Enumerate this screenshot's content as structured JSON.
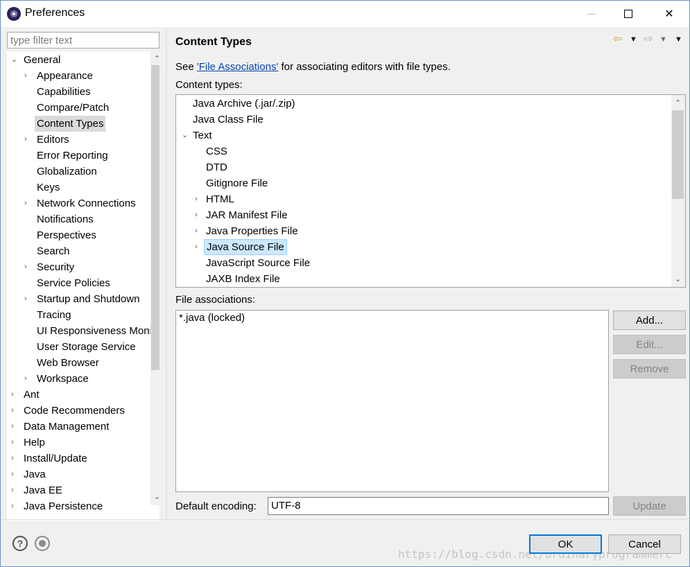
{
  "window": {
    "title": "Preferences",
    "minimize_glyph": "—",
    "close_glyph": "✕"
  },
  "left": {
    "filter_placeholder": "type filter text",
    "tree": [
      {
        "label": "General",
        "level": 0,
        "chevron": "⌄"
      },
      {
        "label": "Appearance",
        "level": 1,
        "chevron": "›"
      },
      {
        "label": "Capabilities",
        "level": 1,
        "chevron": ""
      },
      {
        "label": "Compare/Patch",
        "level": 1,
        "chevron": ""
      },
      {
        "label": "Content Types",
        "level": 1,
        "chevron": "",
        "selected": true
      },
      {
        "label": "Editors",
        "level": 1,
        "chevron": "›"
      },
      {
        "label": "Error Reporting",
        "level": 1,
        "chevron": ""
      },
      {
        "label": "Globalization",
        "level": 1,
        "chevron": ""
      },
      {
        "label": "Keys",
        "level": 1,
        "chevron": ""
      },
      {
        "label": "Network Connections",
        "level": 1,
        "chevron": "›"
      },
      {
        "label": "Notifications",
        "level": 1,
        "chevron": ""
      },
      {
        "label": "Perspectives",
        "level": 1,
        "chevron": ""
      },
      {
        "label": "Search",
        "level": 1,
        "chevron": ""
      },
      {
        "label": "Security",
        "level": 1,
        "chevron": "›"
      },
      {
        "label": "Service Policies",
        "level": 1,
        "chevron": ""
      },
      {
        "label": "Startup and Shutdown",
        "level": 1,
        "chevron": "›"
      },
      {
        "label": "Tracing",
        "level": 1,
        "chevron": ""
      },
      {
        "label": "UI Responsiveness Monitoring",
        "level": 1,
        "chevron": ""
      },
      {
        "label": "User Storage Service",
        "level": 1,
        "chevron": ""
      },
      {
        "label": "Web Browser",
        "level": 1,
        "chevron": ""
      },
      {
        "label": "Workspace",
        "level": 1,
        "chevron": "›"
      },
      {
        "label": "Ant",
        "level": 0,
        "chevron": "›"
      },
      {
        "label": "Code Recommenders",
        "level": 0,
        "chevron": "›"
      },
      {
        "label": "Data Management",
        "level": 0,
        "chevron": "›"
      },
      {
        "label": "Help",
        "level": 0,
        "chevron": "›"
      },
      {
        "label": "Install/Update",
        "level": 0,
        "chevron": "›"
      },
      {
        "label": "Java",
        "level": 0,
        "chevron": "›"
      },
      {
        "label": "Java EE",
        "level": 0,
        "chevron": "›"
      },
      {
        "label": "Java Persistence",
        "level": 0,
        "chevron": "›"
      }
    ]
  },
  "right": {
    "title": "Content Types",
    "description_prefix": "See ",
    "description_link": "'File Associations'",
    "description_suffix": " for associating editors with file types.",
    "content_types_label": "Content types:",
    "content_types": [
      {
        "label": "Java Archive (.jar/.zip)",
        "level": 0,
        "chevron": ""
      },
      {
        "label": "Java Class File",
        "level": 0,
        "chevron": ""
      },
      {
        "label": "Text",
        "level": 0,
        "chevron": "⌄"
      },
      {
        "label": "CSS",
        "level": 1,
        "chevron": ""
      },
      {
        "label": "DTD",
        "level": 1,
        "chevron": ""
      },
      {
        "label": "Gitignore File",
        "level": 1,
        "chevron": ""
      },
      {
        "label": "HTML",
        "level": 1,
        "chevron": "›"
      },
      {
        "label": "JAR Manifest File",
        "level": 1,
        "chevron": "›"
      },
      {
        "label": "Java Properties File",
        "level": 1,
        "chevron": "›"
      },
      {
        "label": "Java Source File",
        "level": 1,
        "chevron": "›",
        "selected": true
      },
      {
        "label": "JavaScript Source File",
        "level": 1,
        "chevron": ""
      },
      {
        "label": "JAXB Index File",
        "level": 1,
        "chevron": ""
      }
    ],
    "file_associations_label": "File associations:",
    "file_associations": [
      "*.java (locked)"
    ],
    "buttons": {
      "add": "Add...",
      "edit": "Edit...",
      "remove": "Remove",
      "update": "Update"
    },
    "default_encoding_label": "Default encoding:",
    "default_encoding_value": "UTF-8"
  },
  "footer": {
    "help_glyph": "?",
    "ok": "OK",
    "cancel": "Cancel",
    "watermark": "https://blog.csdn.net/ordinaryprogrammerc"
  }
}
